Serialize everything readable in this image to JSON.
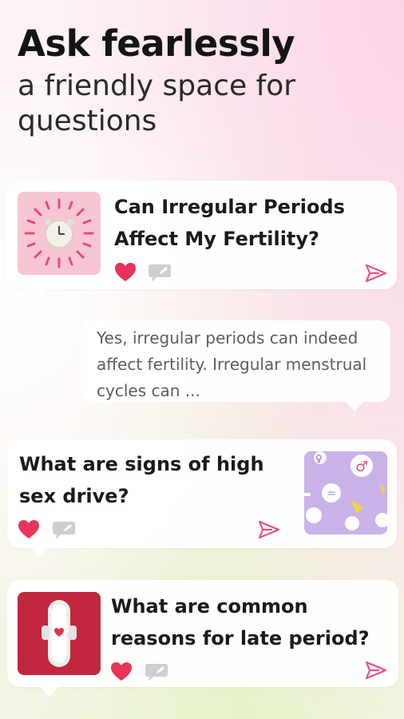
{
  "header": {
    "title": "Ask fearlessly",
    "subtitle_line1": "a friendly space for",
    "subtitle_line2": "questions"
  },
  "cards": [
    {
      "question_line1": "Can Irregular Periods",
      "question_line2": "Affect My Fertility?",
      "thumbnail": "alarm-clock-icon"
    },
    {
      "question_line1": "What are signs of high",
      "question_line2": "sex drive?",
      "thumbnail": "gender-symbols-icon"
    },
    {
      "question_line1": "What are common",
      "question_line2": "reasons for late period?",
      "thumbnail": "sanitary-pad-icon"
    }
  ],
  "answer": {
    "line1": "Yes, irregular periods can indeed",
    "line2": "affect fertility. Irregular menstrual",
    "line3": "cycles can ..."
  },
  "colors": {
    "accent": "#e8345a",
    "send": "#ec4f86",
    "chat_icon": "#c9c9c9"
  }
}
